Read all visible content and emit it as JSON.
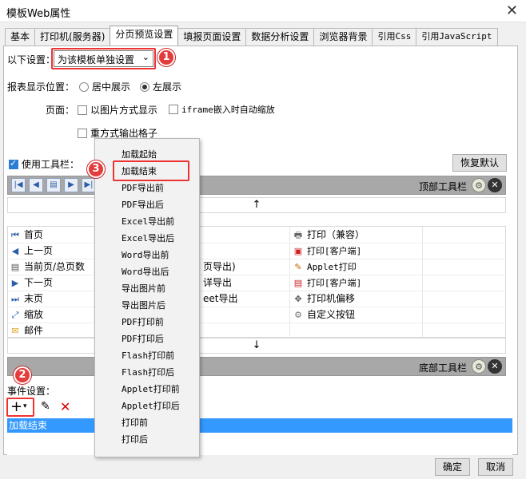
{
  "window": {
    "title": "模板Web属性",
    "close": "✕"
  },
  "tabs": [
    {
      "label": "基本"
    },
    {
      "label": "打印机(服务器)"
    },
    {
      "label": "分页预览设置"
    },
    {
      "label": "填报页面设置"
    },
    {
      "label": "数据分析设置"
    },
    {
      "label": "浏览器背景"
    },
    {
      "label": "引用Css"
    },
    {
      "label": "引用JavaScript"
    }
  ],
  "settings": {
    "label": "以下设置：",
    "value": "为该模板单独设置",
    "position_label": "报表显示位置：",
    "center": "居中展示",
    "left": "左展示",
    "page_label": "页面：",
    "image_mode": "以图片方式显示",
    "iframe_zoom": "iframe嵌入时自动缩放",
    "grid_output": "重方式输出格子"
  },
  "toolbar": {
    "use_label": "使用工具栏：",
    "restore_default": "恢复默认",
    "top_label": "顶部工具栏",
    "bottom_label": "底部工具栏",
    "up_arrow": "↑",
    "down_arrow": "↓"
  },
  "grid": {
    "col1": [
      {
        "icon": "first-page-icon",
        "glyph": "⏮",
        "label": "首页"
      },
      {
        "icon": "prev-page-icon",
        "glyph": "◀",
        "label": "上一页"
      },
      {
        "icon": "page-count-icon",
        "glyph": "▤",
        "label": "当前页/总页数"
      },
      {
        "icon": "next-page-icon",
        "glyph": "▶",
        "label": "下一页"
      },
      {
        "icon": "last-page-icon",
        "glyph": "⏭",
        "label": "末页"
      },
      {
        "icon": "zoom-icon",
        "glyph": "⤢",
        "label": "缩放"
      },
      {
        "icon": "mail-icon",
        "glyph": "✉",
        "label": "邮件"
      }
    ],
    "col2": [
      "页导出)",
      "详导出",
      "eet导出"
    ],
    "col3": [
      {
        "icon": "print-icon",
        "glyph": "🖶",
        "label": "打印（兼容）"
      },
      {
        "icon": "pdf-print-icon",
        "glyph": "▣",
        "label": "打印[客户端]"
      },
      {
        "icon": "applet-print-icon",
        "glyph": "✎",
        "label": "Applet打印"
      },
      {
        "icon": "pdf-print-client-icon",
        "glyph": "▤",
        "label": "打印[客户端]"
      },
      {
        "icon": "printer-offset-icon",
        "glyph": "✥",
        "label": "打印机偏移"
      },
      {
        "icon": "custom-button-icon",
        "glyph": "⚙",
        "label": "自定义按钮"
      }
    ]
  },
  "events": {
    "label": "事件设置：",
    "selected": "加载结束"
  },
  "menu": {
    "items": [
      "加载起始",
      "加载结束",
      "PDF导出前",
      "PDF导出后",
      "Excel导出前",
      "Excel导出后",
      "Word导出前",
      "Word导出后",
      "导出图片前",
      "导出图片后",
      "PDF打印前",
      "PDF打印后",
      "Flash打印前",
      "Flash打印后",
      "Applet打印前",
      "Applet打印后",
      "打印前",
      "打印后"
    ]
  },
  "badges": {
    "b1": "1",
    "b2": "2",
    "b3": "3"
  },
  "footer": {
    "ok": "确定",
    "cancel": "取消"
  },
  "colors": {
    "accent": "#3399ff",
    "callout": "#e43c3c"
  }
}
